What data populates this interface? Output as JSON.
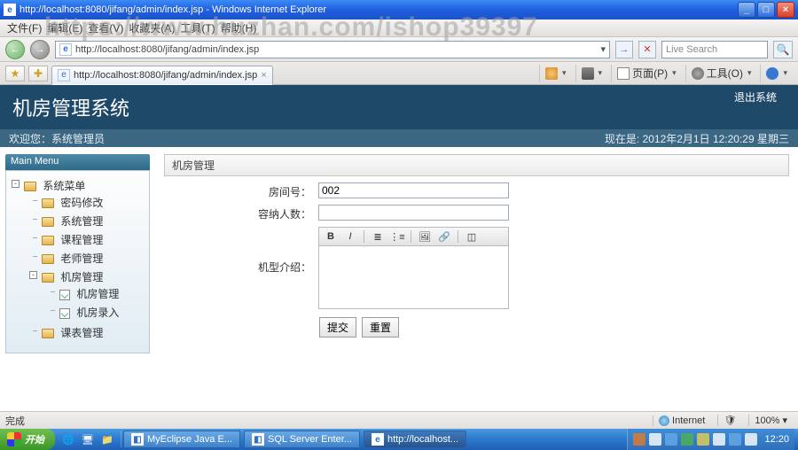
{
  "window": {
    "title": "http://localhost:8080/jifang/admin/index.jsp - Windows Internet Explorer"
  },
  "watermark": "https://www.huzhan.com/ishop39397",
  "ie": {
    "menu": [
      "文件(F)",
      "编辑(E)",
      "查看(V)",
      "收藏夹(A)",
      "工具(T)",
      "帮助(H)"
    ],
    "address": "http://localhost:8080/jifang/admin/index.jsp",
    "search_placeholder": "Live Search",
    "tab_title": "http://localhost:8080/jifang/admin/index.jsp",
    "toolbar": {
      "page": "页面(P)",
      "tools": "工具(O)"
    },
    "status": {
      "done": "完成",
      "zone": "Internet",
      "zoom": "100%"
    }
  },
  "app": {
    "title": "机房管理系统",
    "logout": "退出系统",
    "welcome_label": "欢迎您：",
    "welcome_user": "系统管理员",
    "now_label": "现在是:",
    "datetime": "2012年2月1日  12:20:29 星期三"
  },
  "menu": {
    "header": "Main Menu",
    "root": "系统菜单",
    "items": [
      {
        "label": "密码修改",
        "type": "leaf"
      },
      {
        "label": "系统管理",
        "type": "leaf"
      },
      {
        "label": "课程管理",
        "type": "leaf"
      },
      {
        "label": "老师管理",
        "type": "leaf"
      },
      {
        "label": "机房管理",
        "type": "folder",
        "children": [
          {
            "label": "机房管理"
          },
          {
            "label": "机房录入"
          }
        ]
      },
      {
        "label": "课表管理",
        "type": "leaf"
      }
    ]
  },
  "form": {
    "panel_title": "机房管理",
    "fields": {
      "room_no": {
        "label": "房间号：",
        "value": "002"
      },
      "capacity": {
        "label": "容纳人数：",
        "value": ""
      },
      "intro": {
        "label": "机型介绍：",
        "value": ""
      }
    },
    "editor_buttons": [
      "B",
      "I",
      "ol",
      "ul",
      "img",
      "link",
      "src"
    ],
    "submit": "提交",
    "reset": "重置"
  },
  "taskbar": {
    "start": "开始",
    "items": [
      {
        "label": "MyEclipse Java E..."
      },
      {
        "label": "SQL Server Enter..."
      },
      {
        "label": "http://localhost..."
      }
    ],
    "clock": "12:20"
  }
}
